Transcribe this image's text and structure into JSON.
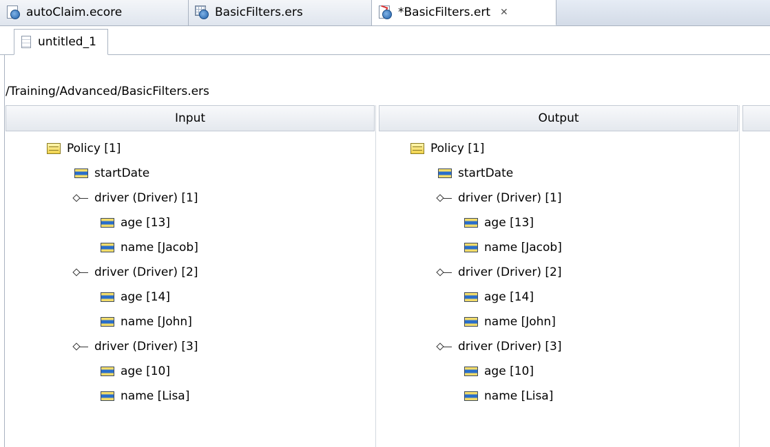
{
  "editor_tabs": [
    {
      "label": "autoClaim.ecore",
      "icon": "ecore-file-icon"
    },
    {
      "label": "BasicFilters.ers",
      "icon": "ruleset-file-icon"
    },
    {
      "label": "*BasicFilters.ert",
      "icon": "ruletest-file-icon",
      "close": "✕"
    }
  ],
  "sub_tab": {
    "label": "untitled_1"
  },
  "path": "/Training/Advanced/BasicFilters.ers",
  "columns": {
    "input": "Input",
    "output": "Output"
  },
  "tree": {
    "policy": "Policy [1]",
    "start_date": "startDate",
    "drivers": [
      {
        "label": "driver (Driver) [1]",
        "age": "age [13]",
        "name": "name [Jacob]"
      },
      {
        "label": "driver (Driver) [2]",
        "age": "age [14]",
        "name": "name [John]"
      },
      {
        "label": "driver (Driver) [3]",
        "age": "age [10]",
        "name": "name [Lisa]"
      }
    ]
  }
}
